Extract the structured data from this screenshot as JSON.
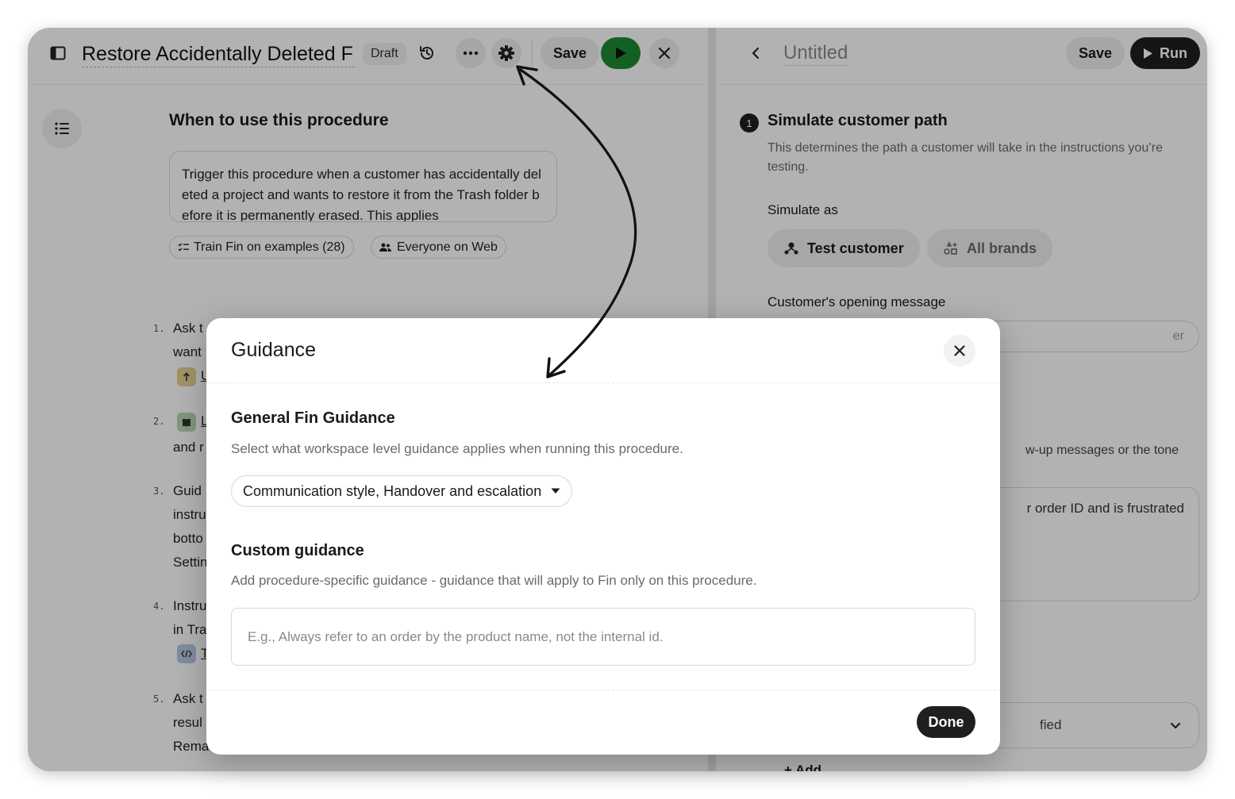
{
  "toolbar": {
    "title": "Restore Accidentally Deleted F",
    "draft_badge": "Draft",
    "save_label": "Save"
  },
  "procedure": {
    "section_heading": "When to use this procedure",
    "trigger_text": "Trigger this procedure when a customer has accidentally deleted a project and wants to restore it from the Trash folder before it is permanently erased. This applies",
    "chips": {
      "train": "Train Fin on examples (28)",
      "audience": "Everyone on Web"
    },
    "steps": [
      {
        "num": "1.",
        "lines": [
          "Ask t",
          "want"
        ],
        "tag_letter": "U"
      },
      {
        "num": "2.",
        "lines": [
          "L",
          "and r"
        ]
      },
      {
        "num": "3.",
        "lines": [
          "Guid",
          "instru",
          "botto",
          "Settin"
        ]
      },
      {
        "num": "4.",
        "lines": [
          "Instru",
          "in Tra"
        ],
        "tag_letter": "T"
      },
      {
        "num": "5.",
        "lines": [
          "Ask t",
          "resul",
          "Rema"
        ]
      }
    ]
  },
  "test_panel": {
    "title": "Untitled",
    "save_label": "Save",
    "run_label": "Run",
    "step_number": "1",
    "heading": "Simulate customer path",
    "description": "This determines the path a customer will take in the instructions you’re testing.",
    "simulate_as_label": "Simulate as",
    "test_customer_label": "Test customer",
    "all_brands_label": "All brands",
    "opening_message_label": "Customer's opening message",
    "opening_message_tail": "er",
    "followup_tail": "w-up messages or the tone",
    "textarea_tail": "r order ID and is frustrated",
    "select_tail": "fied",
    "add_label": "+ Add"
  },
  "modal": {
    "title": "Guidance",
    "general_heading": "General Fin Guidance",
    "general_desc": "Select what workspace level guidance applies when running this procedure.",
    "general_selected": "Communication style, Handover and escalation",
    "custom_heading": "Custom guidance",
    "custom_desc": "Add procedure-specific guidance - guidance that will apply to Fin only on this procedure.",
    "custom_placeholder": "E.g., Always refer to an order by the product name, not the internal id.",
    "done_label": "Done"
  },
  "colors": {
    "run_green": "#1e8a32",
    "dark_button": "#1f1f1f",
    "scrim": "rgba(0,0,0,0.30)"
  },
  "icons": {
    "sidebar_toggle": "sidebar-toggle-icon",
    "history": "history-icon",
    "more": "more-horizontal-icon",
    "settings": "gear-icon",
    "play": "play-icon",
    "close": "close-icon",
    "back": "chevron-left-icon",
    "outline": "list-icon",
    "chevron_down": "chevron-down-icon",
    "caret_down": "caret-down-icon",
    "annotation_arrow": "curved-arrow-icon"
  }
}
